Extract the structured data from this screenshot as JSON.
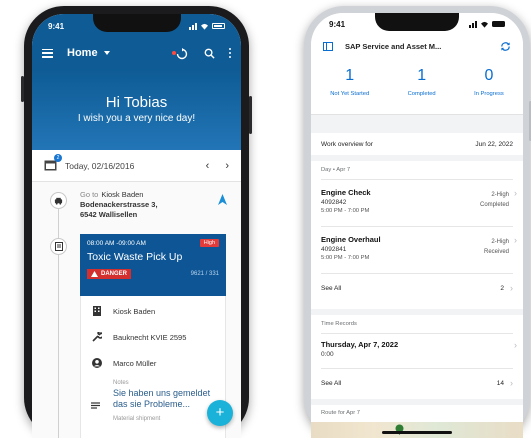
{
  "left": {
    "status_time": "9:41",
    "app_title": "Home",
    "greeting": "Hi Tobias",
    "subgreeting": "I wish you a very nice day!",
    "date_label": "Today, 02/16/2016",
    "calendar_badge": "2",
    "goto_label": "Go to",
    "goto_place": "Kiosk Baden",
    "goto_street": "Bodenackerstrasse 3,",
    "goto_city": "6542 Wallisellen",
    "task": {
      "time": "08:00 AM -09:00 AM",
      "priority": "High",
      "title": "Toxic Waste Pick Up",
      "danger": "DANGER",
      "number": "9621 / 331"
    },
    "detail": {
      "location": "Kiosk Baden",
      "equipment": "Bauknecht KVIE 2595",
      "person": "Marco Müller",
      "notes_label": "Notes",
      "notes_text": "Sie haben uns gemeldet das sie Probleme...",
      "material_label": "Material shipment"
    },
    "fab_label": "+"
  },
  "right": {
    "status_time": "9:41",
    "app_title": "SAP Service and Asset M...",
    "kpis": [
      {
        "value": "1",
        "label": "Not Yet Started"
      },
      {
        "value": "1",
        "label": "Completed"
      },
      {
        "value": "0",
        "label": "In Progress"
      }
    ],
    "overview_label": "Work overview for",
    "overview_date": "Jun 22, 2022",
    "day_label": "Day • Apr 7",
    "orders": [
      {
        "name": "Engine Check",
        "id": "4092842",
        "time": "5:00 PM - 7:00 PM",
        "priority": "2-High",
        "status": "Completed"
      },
      {
        "name": "Engine Overhaul",
        "id": "4092841",
        "time": "5:00 PM - 7:00 PM",
        "priority": "2-High",
        "status": "Received"
      }
    ],
    "see_all_1": "See All",
    "see_all_1_count": "2",
    "time_records_label": "Time Records",
    "time_record_date": "Thursday, Apr 7, 2022",
    "time_record_value": "0:00",
    "see_all_2": "See All",
    "see_all_2_count": "14",
    "route_label": "Route for Apr 7"
  },
  "colors": {
    "left_primary": "#0e5b95",
    "task_card": "#0d5595",
    "danger": "#d32f2f",
    "fab": "#1ab2d8",
    "sap_blue": "#0a6ed1"
  }
}
